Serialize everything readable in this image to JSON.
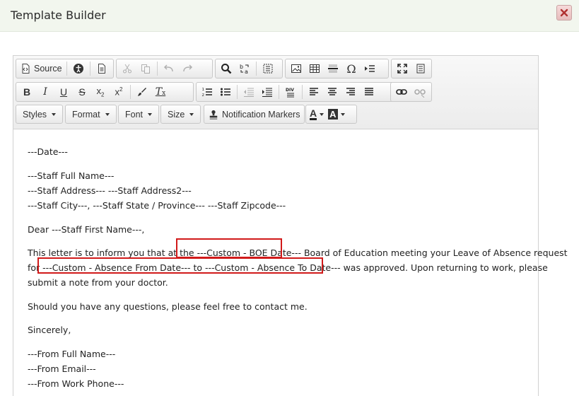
{
  "dialog": {
    "title": "Template Builder"
  },
  "toolbar": {
    "source_label": "Source",
    "styles_label": "Styles",
    "format_label": "Format",
    "font_label": "Font",
    "size_label": "Size",
    "notification_label": "Notification Markers",
    "font_color_letter": "A",
    "bg_color_letter": "A"
  },
  "body": {
    "date": "---Date---",
    "staff_full_name": "---Staff Full Name---",
    "staff_address": "---Staff Address--- ---Staff Address2---",
    "staff_city_line": "---Staff City---, ---Staff State / Province--- ---Staff Zipcode---",
    "salutation": "Dear ---Staff First Name---,",
    "para1_line1_a": "This letter is to inform you that at the ",
    "para1_line1_marker": "---Custom - BOE Date---",
    "para1_line1_b": " Board of Education meeting your Leave of Absence request",
    "para1_line2_a": "for ",
    "para1_line2_marker": "---Custom - Absence From Date--- to ---Custom - Absence To Date---",
    "para1_line2_b": " was approved. Upon returning to work, please",
    "para1_line3": "submit a note from your doctor.",
    "para2": "Should you have any questions, please feel free to contact me.",
    "closing": "Sincerely,",
    "from_name": "---From Full Name---",
    "from_email": "---From Email---",
    "from_phone": "---From Work Phone---"
  },
  "colors": {
    "highlight": "#d11a1a",
    "header_bg": "#f2f6ee"
  }
}
